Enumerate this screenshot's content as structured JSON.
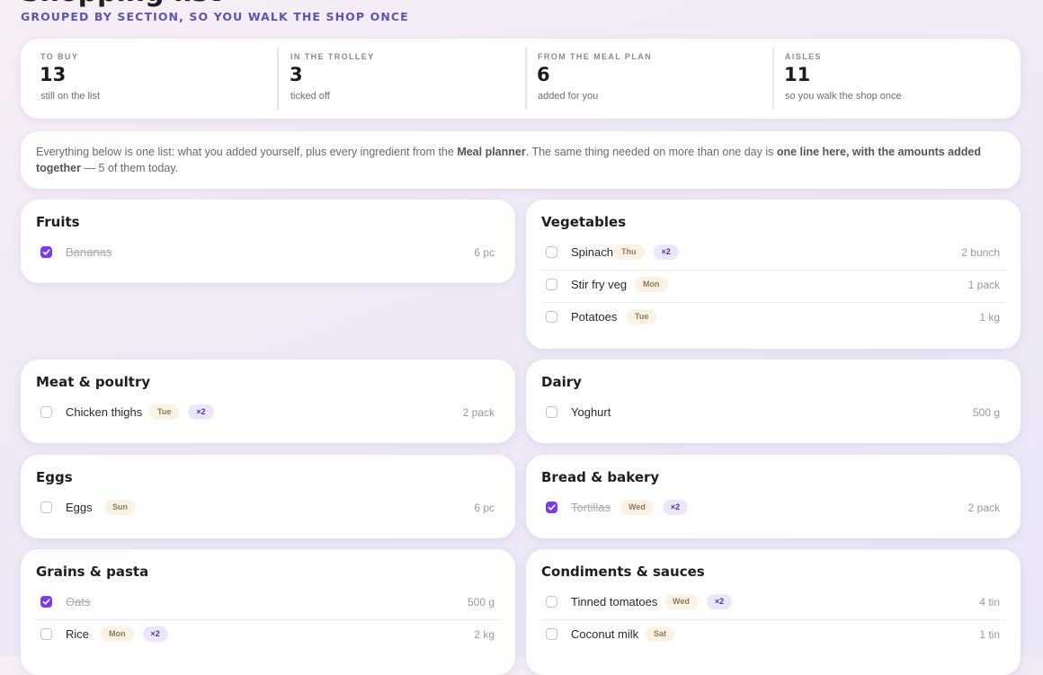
{
  "header": {
    "title": "Shopping list",
    "subtitle": "GROUPED BY SECTION, SO YOU WALK THE SHOP ONCE"
  },
  "stats": [
    {
      "label": "TO BUY",
      "value": "13",
      "sub": "still on the list"
    },
    {
      "label": "IN THE TROLLEY",
      "value": "3",
      "sub": "ticked off"
    },
    {
      "label": "FROM THE MEAL PLAN",
      "value": "6",
      "sub": "added for you"
    },
    {
      "label": "AISLES",
      "value": "11",
      "sub": "so you walk the shop once"
    }
  ],
  "note": {
    "part1": "Everything below is one list: what you added yourself, plus every ingredient from the ",
    "bold1": "Meal planner",
    "part2": ". The same thing needed on more than one day is ",
    "bold2": "one line here, with the amounts added together",
    "part3": " — 5 of them today."
  },
  "colors": {
    "accent": "#7c3aed",
    "subtitle": "#5a55b8",
    "day_chip_bg": "#fbf2e3",
    "multi_chip_bg": "#ece6fb"
  },
  "sections": [
    {
      "title": "Fruits",
      "items": [
        {
          "name": "Bananas",
          "checked": true,
          "days": [],
          "mult": "",
          "qty": "6 pc"
        }
      ]
    },
    {
      "title": "Vegetables",
      "items": [
        {
          "name": "Spinach",
          "checked": false,
          "days": [
            "Thu"
          ],
          "mult": "×2",
          "qty": "2 bunch"
        },
        {
          "name": "Stir fry veg",
          "checked": false,
          "days": [
            "Mon"
          ],
          "mult": "",
          "qty": "1 pack"
        },
        {
          "name": "Potatoes",
          "checked": false,
          "days": [
            "Tue"
          ],
          "mult": "",
          "qty": "1 kg"
        }
      ]
    },
    {
      "title": "Meat & poultry",
      "items": [
        {
          "name": "Chicken thighs",
          "checked": false,
          "days": [
            "Tue"
          ],
          "mult": "×2",
          "qty": "2 pack"
        }
      ]
    },
    {
      "title": "Dairy",
      "items": [
        {
          "name": "Yoghurt",
          "checked": false,
          "days": [],
          "mult": "",
          "qty": "500 g"
        }
      ]
    },
    {
      "title": "Eggs",
      "items": [
        {
          "name": "Eggs",
          "checked": false,
          "days": [
            "Sun"
          ],
          "mult": "",
          "qty": "6 pc"
        }
      ]
    },
    {
      "title": "Bread & bakery",
      "items": [
        {
          "name": "Tortillas",
          "checked": true,
          "days": [
            "Wed"
          ],
          "mult": "×2",
          "qty": "2 pack"
        }
      ]
    },
    {
      "title": "Grains & pasta",
      "items": [
        {
          "name": "Oats",
          "checked": true,
          "days": [],
          "mult": "",
          "qty": "500 g"
        },
        {
          "name": "Rice",
          "checked": false,
          "days": [
            "Mon"
          ],
          "mult": "×2",
          "qty": "2 kg"
        }
      ]
    },
    {
      "title": "Condiments & sauces",
      "items": [
        {
          "name": "Tinned tomatoes",
          "checked": false,
          "days": [
            "Wed"
          ],
          "mult": "×2",
          "qty": "4 tin"
        },
        {
          "name": "Coconut milk",
          "checked": false,
          "days": [
            "Sat"
          ],
          "mult": "",
          "qty": "1 tin"
        }
      ]
    }
  ]
}
